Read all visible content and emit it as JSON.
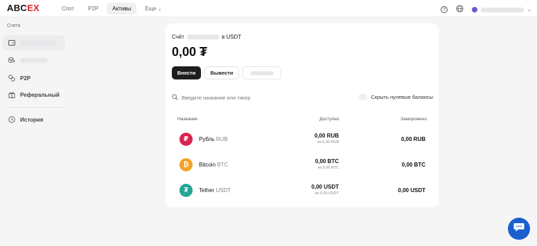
{
  "brand": {
    "logo_main": "ABC",
    "logo_accent": "EX"
  },
  "nav": {
    "items": [
      {
        "label": "Спот"
      },
      {
        "label": "P2P"
      },
      {
        "label": "Активы"
      },
      {
        "label": "Еще"
      }
    ]
  },
  "sidebar": {
    "title": "Счета",
    "items": [
      {
        "label": "",
        "icon": "wallet-icon"
      },
      {
        "label": "",
        "icon": "coins-icon"
      },
      {
        "label": "P2P",
        "icon": "p2p-icon"
      },
      {
        "label": "Реферальный",
        "icon": "gift-icon"
      },
      {
        "label": "История",
        "icon": "clock-icon"
      }
    ]
  },
  "account": {
    "label_prefix": "Счёт",
    "label_suffix": "в USDT",
    "balance": "0,00 ₮"
  },
  "actions": {
    "deposit": "Внести",
    "withdraw": "Вывести"
  },
  "search": {
    "placeholder": "Введите название или тикер"
  },
  "toggle": {
    "label": "Скрыть нулевые балансы"
  },
  "table": {
    "headers": {
      "name": "Название",
      "available": "Доступно",
      "frozen": "Заморожено"
    },
    "rows": [
      {
        "name": "Рубль",
        "ticker": "RUB",
        "available": "0,00 RUB",
        "available_sub": "из 0,00 RUB",
        "frozen": "0,00 RUB",
        "color": "#d9264f",
        "icon": "ruble-icon",
        "glyph": "₽"
      },
      {
        "name": "Bitcoin",
        "ticker": "BTC",
        "available": "0,00 BTC",
        "available_sub": "из 0,00 BTC",
        "frozen": "0,00 BTC",
        "color": "#f3a126",
        "icon": "bitcoin-icon",
        "glyph": "₿"
      },
      {
        "name": "Tether",
        "ticker": "USDT",
        "available": "0,00 USDT",
        "available_sub": "из 0,00 USDT",
        "frozen": "0,00 USDT",
        "color": "#27a595",
        "icon": "tether-icon",
        "glyph": "₮"
      }
    ]
  }
}
